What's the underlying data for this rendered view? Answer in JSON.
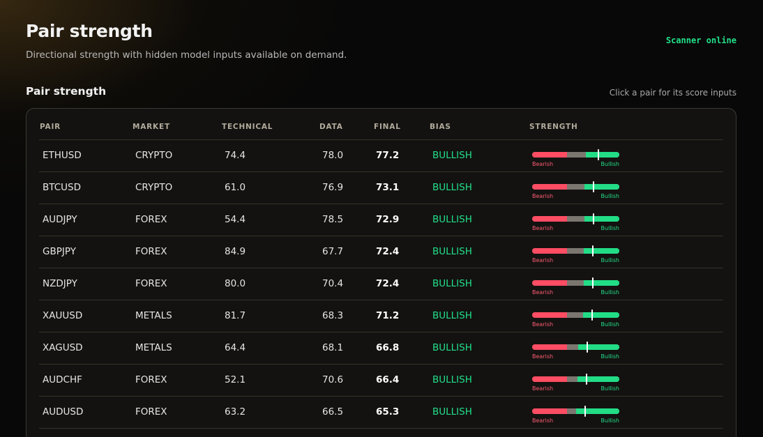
{
  "header": {
    "title": "Pair strength",
    "subtitle": "Directional strength with hidden model inputs available on demand.",
    "status": "Scanner online"
  },
  "section": {
    "title": "Pair strength",
    "hint": "Click a pair for its score inputs"
  },
  "table": {
    "columns": [
      "PAIR",
      "MARKET",
      "TECHNICAL",
      "DATA",
      "FINAL",
      "BIAS",
      "STRENGTH"
    ],
    "meter_labels": {
      "left": "Bearish",
      "right": "Bullish"
    },
    "rows": [
      {
        "pair": "ETHUSD",
        "market": "CRYPTO",
        "technical": "74.4",
        "data": "78.0",
        "final": "77.2",
        "bias": "BULLISH"
      },
      {
        "pair": "BTCUSD",
        "market": "CRYPTO",
        "technical": "61.0",
        "data": "76.9",
        "final": "73.1",
        "bias": "BULLISH"
      },
      {
        "pair": "AUDJPY",
        "market": "FOREX",
        "technical": "54.4",
        "data": "78.5",
        "final": "72.9",
        "bias": "BULLISH"
      },
      {
        "pair": "GBPJPY",
        "market": "FOREX",
        "technical": "84.9",
        "data": "67.7",
        "final": "72.4",
        "bias": "BULLISH"
      },
      {
        "pair": "NZDJPY",
        "market": "FOREX",
        "technical": "80.0",
        "data": "70.4",
        "final": "72.4",
        "bias": "BULLISH"
      },
      {
        "pair": "XAUUSD",
        "market": "METALS",
        "technical": "81.7",
        "data": "68.3",
        "final": "71.2",
        "bias": "BULLISH"
      },
      {
        "pair": "XAGUSD",
        "market": "METALS",
        "technical": "64.4",
        "data": "68.1",
        "final": "66.8",
        "bias": "BULLISH"
      },
      {
        "pair": "AUDCHF",
        "market": "FOREX",
        "technical": "52.1",
        "data": "70.6",
        "final": "66.4",
        "bias": "BULLISH"
      },
      {
        "pair": "AUDUSD",
        "market": "FOREX",
        "technical": "63.2",
        "data": "66.5",
        "final": "65.3",
        "bias": "BULLISH"
      }
    ]
  },
  "colors": {
    "bullish": "#22dd86",
    "bearish": "#ff4d63",
    "neutral": "#7b7770"
  }
}
